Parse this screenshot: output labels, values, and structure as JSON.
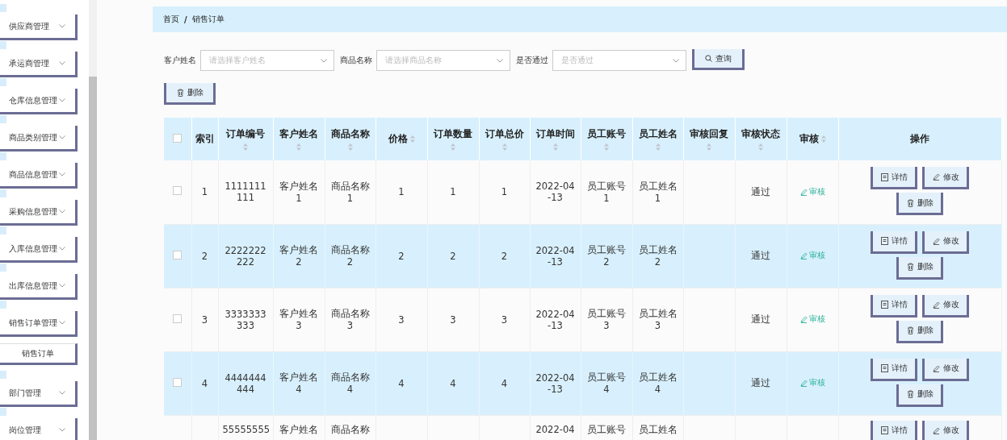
{
  "sidebar": {
    "items": [
      {
        "label": "供应商管理"
      },
      {
        "label": "承运商管理"
      },
      {
        "label": "仓库信息管理"
      },
      {
        "label": "商品类别管理"
      },
      {
        "label": "商品信息管理"
      },
      {
        "label": "采购信息管理"
      },
      {
        "label": "入库信息管理"
      },
      {
        "label": "出库信息管理"
      },
      {
        "label": "销售订单管理",
        "children": [
          {
            "label": "销售订单"
          }
        ]
      },
      {
        "label": "部门管理"
      },
      {
        "label": "岗位管理"
      }
    ]
  },
  "breadcrumb": {
    "items": [
      "首页",
      "销售订单"
    ],
    "separator": "/"
  },
  "filters": [
    {
      "label": "客户姓名",
      "placeholder": "请选择客户姓名"
    },
    {
      "label": "商品名称",
      "placeholder": "请选择商品名称"
    },
    {
      "label": "是否通过",
      "placeholder": "是否通过"
    }
  ],
  "search_button": "查询",
  "delete_button": "删除",
  "table": {
    "all_checked": false,
    "columns": [
      {
        "label": "索引",
        "kind": "plain"
      },
      {
        "label": "订单编号",
        "kind": "sortbelow"
      },
      {
        "label": "客户姓名",
        "kind": "sortbelow"
      },
      {
        "label": "商品名称",
        "kind": "sortbelow"
      },
      {
        "label": "价格",
        "kind": "sortinline"
      },
      {
        "label": "订单数量",
        "kind": "sortbelow"
      },
      {
        "label": "订单总价",
        "kind": "sortbelow"
      },
      {
        "label": "订单时间",
        "kind": "sortbelow"
      },
      {
        "label": "员工账号",
        "kind": "sortbelow"
      },
      {
        "label": "员工姓名",
        "kind": "sortbelow"
      },
      {
        "label": "审核回复",
        "kind": "sortbelow"
      },
      {
        "label": "审核状态",
        "kind": "sortbelow"
      },
      {
        "label": "审核",
        "kind": "sortinline"
      },
      {
        "label": "操作",
        "kind": "plain"
      }
    ],
    "rows": [
      {
        "kind": "full",
        "checked": false,
        "index": "1",
        "order_no": "1111111111",
        "customer": "客户姓名1",
        "product": "商品名称1",
        "price": "1",
        "quantity": "1",
        "total": "1",
        "time": "2022-04-13",
        "staff_account": "员工账号1",
        "staff_name": "员工姓名1",
        "status": "通过",
        "audit_link": "审核",
        "actions": [
          "详情",
          "修改",
          "删除"
        ]
      },
      {
        "kind": "full",
        "checked": false,
        "index": "2",
        "order_no": "2222222222",
        "customer": "客户姓名2",
        "product": "商品名称2",
        "price": "2",
        "quantity": "2",
        "total": "2",
        "time": "2022-04-13",
        "staff_account": "员工账号2",
        "staff_name": "员工姓名2",
        "status": "通过",
        "audit_link": "审核",
        "actions": [
          "详情",
          "修改",
          "删除"
        ]
      },
      {
        "kind": "full",
        "checked": false,
        "index": "3",
        "order_no": "3333333333",
        "customer": "客户姓名3",
        "product": "商品名称3",
        "price": "3",
        "quantity": "3",
        "total": "3",
        "time": "2022-04-13",
        "staff_account": "员工账号3",
        "staff_name": "员工姓名3",
        "status": "通过",
        "audit_link": "审核",
        "actions": [
          "详情",
          "修改",
          "删除"
        ]
      },
      {
        "kind": "full",
        "checked": false,
        "index": "4",
        "order_no": "4444444444",
        "customer": "客户姓名4",
        "product": "商品名称4",
        "price": "4",
        "quantity": "4",
        "total": "4",
        "time": "2022-04-13",
        "staff_account": "员工账号4",
        "staff_name": "员工姓名4",
        "status": "通过",
        "audit_link": "审核",
        "actions": [
          "详情",
          "修改",
          "删除"
        ]
      },
      {
        "kind": "partial",
        "order_no": "55555555",
        "customer": "客户姓名",
        "product": "商品名称",
        "time": "2022-04",
        "staff_account": "员工账号",
        "staff_name": "员工姓名",
        "actions": [
          "详情",
          "修改"
        ]
      }
    ]
  }
}
